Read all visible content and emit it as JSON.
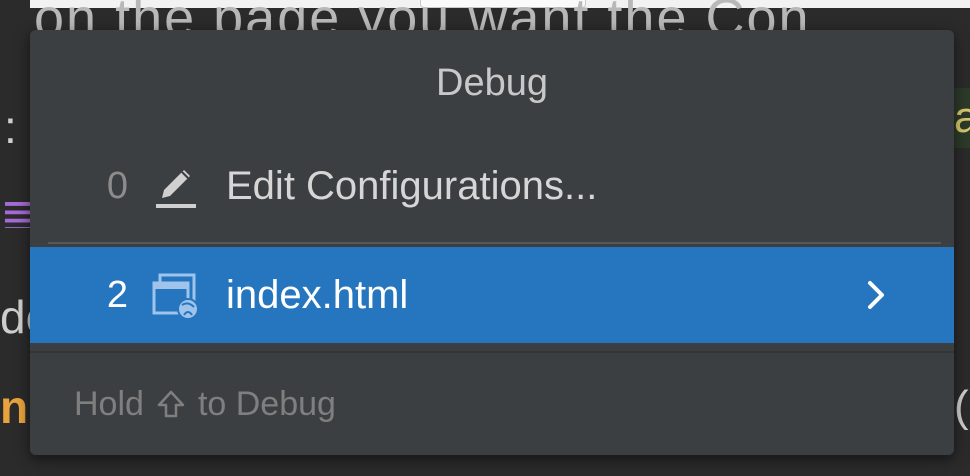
{
  "background": {
    "top_text": "t on the page you want the Con",
    "fragments": {
      "left_a": ":",
      "left_b": "≣",
      "left_c": "de",
      "left_d": "n",
      "right_a": "a",
      "right_b": "("
    }
  },
  "popup": {
    "title": "Debug",
    "items": [
      {
        "mnemonic": "0",
        "label": "Edit Configurations...",
        "icon": "pencil-icon",
        "selected": false
      },
      {
        "mnemonic": "2",
        "label": "index.html",
        "icon": "browser-config-icon",
        "selected": true,
        "has_submenu": true
      }
    ],
    "footer": {
      "prefix": "Hold",
      "key_icon": "shift-key-icon",
      "suffix": "to Debug"
    }
  },
  "colors": {
    "popup_bg": "#3c3f41",
    "selection": "#2675bf",
    "text": "#d6d6d6",
    "muted": "#8c8c8c"
  }
}
